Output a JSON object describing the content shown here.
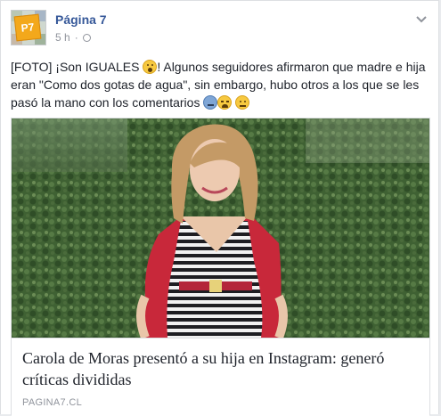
{
  "post": {
    "page_name": "Página 7",
    "time": "5 h",
    "separator": "·",
    "audience_icon": "globe-icon",
    "menu_icon": "chevron-down-icon",
    "text_part1": "[FOTO] ¡Son IGUALES ",
    "emoji_1": "astonished-emoji",
    "text_part2": "! Algunos seguidores afirmaron que madre e hija eran \"Como dos gotas de agua\", sin embargo, hubo otros a los que se les pasó la mano con los comentarios ",
    "emoji_2": "sweat-emoji",
    "emoji_3": "tired-emoji",
    "emoji_4": "expressionless-emoji"
  },
  "avatar": {
    "logo_text": "P7"
  },
  "link_preview": {
    "title": "Carola de Moras presentó a su hija en Instagram: generó críticas divididas",
    "domain": "PAGINA7.CL"
  },
  "colors": {
    "page_name": "#365899",
    "meta": "#90949c",
    "text": "#1d2129",
    "border": "#dddfe2",
    "avatar_logo": "#f3a81b"
  }
}
